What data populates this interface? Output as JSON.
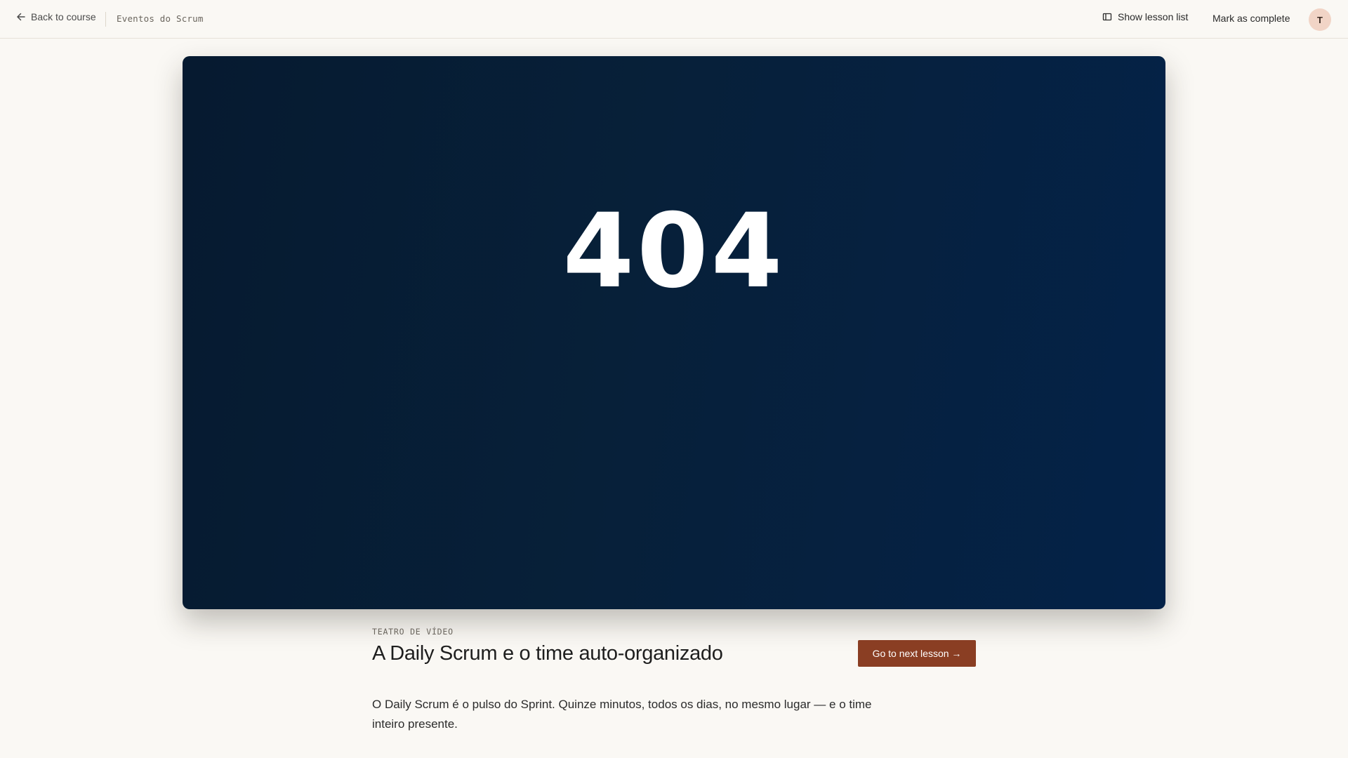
{
  "header": {
    "back_label": "Back to course",
    "course_name": "Eventos do Scrum",
    "lesson_list_label": "Show lesson list",
    "complete_label": "Mark as complete",
    "avatar_initial": "T"
  },
  "video": {
    "error_code": "404"
  },
  "lesson": {
    "eyebrow": "TEATRO DE VÍDEO",
    "title": "A Daily Scrum e o time auto-organizado",
    "next_label": "Go to next lesson →",
    "description": "O Daily Scrum é o pulso do Sprint. Quinze minutos, todos os dias, no mesmo lugar — e o time inteiro presente."
  },
  "colors": {
    "accent": "#8a3e23",
    "video_bg": "#072039",
    "page_bg": "#faf8f4",
    "avatar_bg": "#f1d4c6"
  },
  "icons": {
    "back": "arrow-left-icon",
    "lesson_list": "book-icon"
  }
}
